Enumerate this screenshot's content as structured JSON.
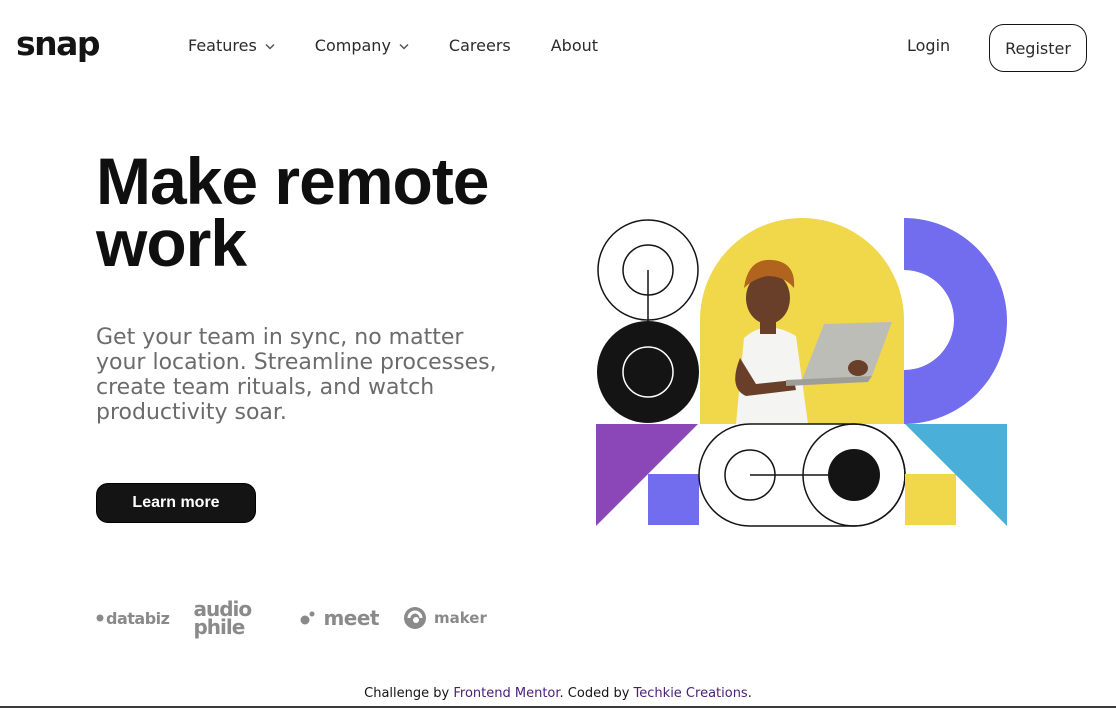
{
  "header": {
    "logo": "snap",
    "nav": [
      {
        "label": "Features",
        "has_dropdown": true
      },
      {
        "label": "Company",
        "has_dropdown": true
      },
      {
        "label": "Careers",
        "has_dropdown": false
      },
      {
        "label": "About",
        "has_dropdown": false
      }
    ],
    "login_label": "Login",
    "register_label": "Register"
  },
  "hero": {
    "title_line1": "Make remote",
    "title_line2": "work",
    "description": "Get your team in sync, no matter your location. Streamline processes, create team rituals, and watch productivity soar.",
    "cta_label": "Learn more"
  },
  "clients": {
    "databiz": "databiz",
    "audiophile_line1": "audio",
    "audiophile_line2": "phile",
    "meet": "meet",
    "maker": "maker"
  },
  "footer": {
    "prefix": "Challenge by ",
    "mentor_link": "Frontend Mentor",
    "middle": ". Coded by ",
    "author_link": "Techkie Creations",
    "suffix": "."
  },
  "colors": {
    "yellow": "#f0d84a",
    "purple": "#8b47b8",
    "violet": "#726cee",
    "blue": "#4aafd9",
    "black": "#141414"
  }
}
